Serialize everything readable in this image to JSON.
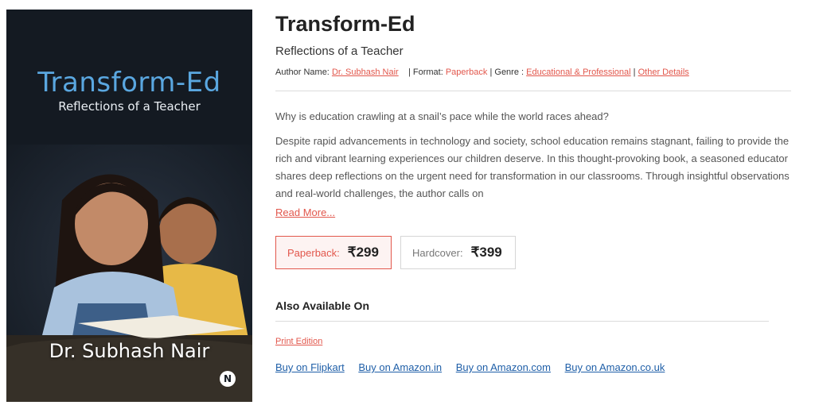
{
  "cover": {
    "title": "Transform-Ed",
    "subtitle": "Reflections of a Teacher",
    "author": "Dr. Subhash Nair",
    "publisher_logo": "N"
  },
  "book": {
    "title": "Transform-Ed",
    "subtitle": "Reflections of a Teacher"
  },
  "meta": {
    "author_label": "Author Name:",
    "author": "Dr. Subhash Nair",
    "format_label": "| Format:",
    "format": "Paperback",
    "genre_label": "| Genre :",
    "genre": "Educational & Professional",
    "separator": "|",
    "other_details": "Other Details"
  },
  "description": {
    "question": "Why is education crawling at a snail’s pace while the world races ahead?",
    "body": "Despite rapid advancements in technology and society, school education remains stagnant, failing to provide the rich and vibrant learning experiences our children deserve. In this thought-provoking book, a seasoned educator shares deep reflections on the urgent need for transformation in our classrooms. Through insightful observations and real-world challenges, the author calls on",
    "read_more": "Read More..."
  },
  "prices": {
    "paperback_label": "Paperback:",
    "paperback_price": "₹299",
    "hardcover_label": "Hardcover:",
    "hardcover_price": "₹399"
  },
  "also_available": {
    "heading": "Also Available On",
    "print_edition": "Print Edition",
    "links": [
      "Buy on Flipkart",
      "Buy on Amazon.in",
      "Buy on Amazon.com",
      "Buy on Amazon.co.uk"
    ]
  },
  "colors": {
    "accent": "#e2574c",
    "link_blue": "#1f5fa8",
    "cover_bg": "#141a22",
    "cover_title": "#5aa7e0"
  }
}
